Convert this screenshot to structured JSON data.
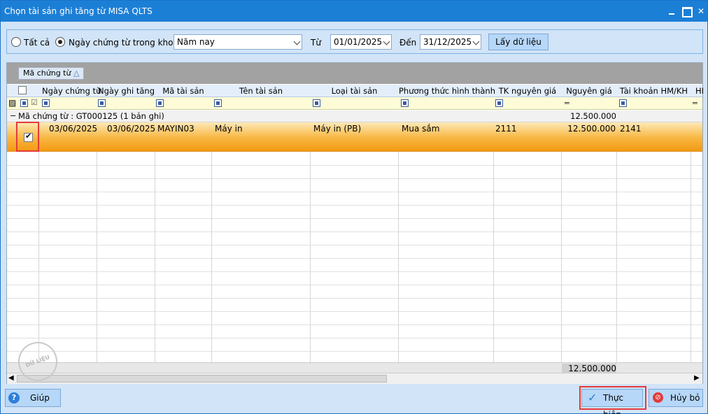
{
  "window": {
    "title": "Chọn tài sản ghi tăng từ MISA QLTS"
  },
  "filter": {
    "radio_all": "Tất cả",
    "radio_range": "Ngày chứng từ trong khoảng",
    "period_value": "Năm nay",
    "from_label": "Từ",
    "from_value": "01/01/2025",
    "to_label": "Đến",
    "to_value": "31/12/2025",
    "load_button": "Lấy dữ liệu"
  },
  "grid": {
    "group_by_tag": "Mã chứng từ",
    "columns": [
      "Ngày chứng từ",
      "Ngày ghi tăng",
      "Mã tài sản",
      "Tên tài sản",
      "Loại tài sản",
      "Phương thức hình thành",
      "TK nguyên giá",
      "Nguyên giá",
      "Tài khoản HM/KH",
      "HI"
    ],
    "group_row": {
      "label": "Mã chứng từ : GT000125 (1 bản ghi)",
      "total": "12.500.000"
    },
    "rows": [
      {
        "ngay_chung_tu": "03/06/2025",
        "ngay_ghi_tang": "03/06/2025",
        "ma_tai_san": "MAYIN03",
        "ten_tai_san": "Máy in",
        "loai_tai_san": "Máy in (PB)",
        "phuong_thuc": "Mua sắm",
        "tk_nguyen_gia": "2111",
        "nguyen_gia": "12.500.000",
        "tk_hm_kh": "2141"
      }
    ],
    "footer_total": "12.500.000",
    "watermark": "DỮ LIỆU MẪU"
  },
  "buttons": {
    "help": "Giúp",
    "execute": "Thực hiện",
    "cancel": "Hủy bỏ"
  },
  "colors": {
    "titlebar": "#1c7fd6",
    "selected_row": "#f8b640",
    "highlight": "#e53a3a"
  }
}
